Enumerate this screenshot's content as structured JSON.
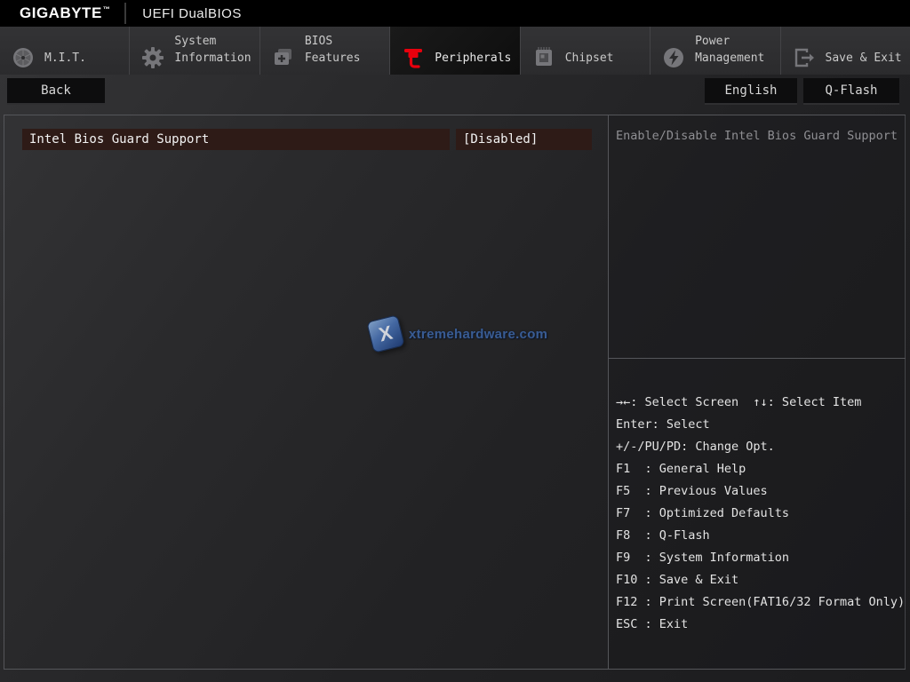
{
  "topbar": {
    "brand": "GIGABYTE",
    "brand_tm": "™",
    "title": "UEFI DualBIOS"
  },
  "tabs": [
    {
      "label": "M.I.T.",
      "active": false
    },
    {
      "label": "System Information",
      "active": false
    },
    {
      "label": "BIOS Features",
      "active": false
    },
    {
      "label": "Peripherals",
      "active": true
    },
    {
      "label": "Chipset",
      "active": false
    },
    {
      "label": "Power Management",
      "active": false
    },
    {
      "label": "Save & Exit",
      "active": false
    }
  ],
  "buttons": {
    "back": "Back",
    "language": "English",
    "qflash": "Q-Flash"
  },
  "main": {
    "option": {
      "label": "Intel Bios Guard Support",
      "value": "[Disabled]"
    }
  },
  "help": {
    "text": "Enable/Disable Intel Bios Guard Support"
  },
  "shortcuts": [
    "→←: Select Screen  ↑↓: Select Item",
    "Enter: Select",
    "+/-/PU/PD: Change Opt.",
    "F1  : General Help",
    "F5  : Previous Values",
    "F7  : Optimized Defaults",
    "F8  : Q-Flash",
    "F9  : System Information",
    "F10 : Save & Exit",
    "F12 : Print Screen(FAT16/32 Format Only)",
    "ESC : Exit"
  ],
  "watermark": {
    "text": "xtremehardware.com",
    "logo_letter": "X"
  },
  "colors": {
    "accent_red": "#e8000d",
    "row_highlight": "#2e1b17",
    "tab_bar": "#2c2c2e",
    "topbar": "#000000",
    "help_text": "#8f8f93"
  }
}
